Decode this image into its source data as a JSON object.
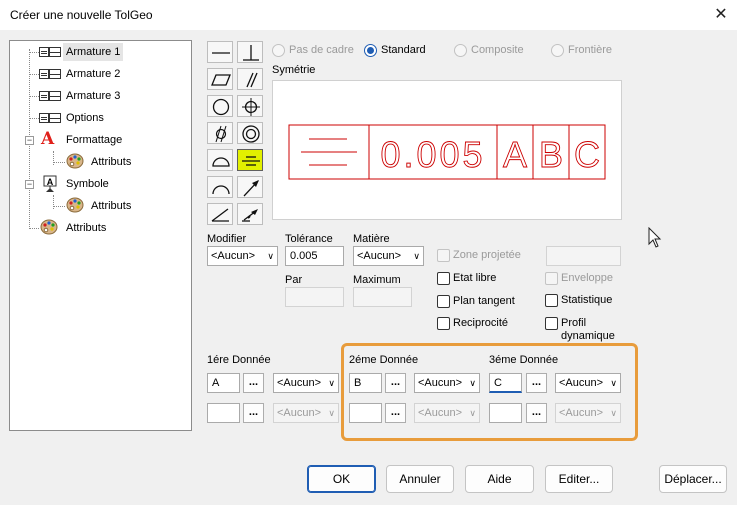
{
  "window": {
    "title": "Créer une nouvelle TolGeo",
    "close": "✕"
  },
  "tree": {
    "items": [
      {
        "label": "Armature 1",
        "icon": "frame-icon"
      },
      {
        "label": "Armature 2",
        "icon": "frame-icon"
      },
      {
        "label": "Armature 3",
        "icon": "frame-icon"
      },
      {
        "label": "Options",
        "icon": "frame-icon"
      },
      {
        "label": "Formattage",
        "icon": "letter-a-icon"
      },
      {
        "label": "Attributs",
        "icon": "palette-icon"
      },
      {
        "label": "Symbole",
        "icon": "symbol-icon"
      },
      {
        "label": "Attributs",
        "icon": "palette-icon"
      },
      {
        "label": "Attributs",
        "icon": "palette-icon"
      }
    ]
  },
  "frame_options": {
    "pas_de_cadre": "Pas de cadre",
    "standard": "Standard",
    "composite": "Composite",
    "frontiere": "Frontière",
    "selected": "Standard"
  },
  "preview": {
    "caption": "Symétrie",
    "tolerance_text": "0.005",
    "datums": [
      "A",
      "B",
      "C"
    ],
    "color": "#cc0000"
  },
  "fields": {
    "modifier": {
      "label": "Modifier",
      "value": "<Aucun>"
    },
    "tolerance": {
      "label": "Tolérance",
      "value": "0.005"
    },
    "matiere": {
      "label": "Matière",
      "value": "<Aucun>"
    },
    "par": {
      "label": "Par"
    },
    "maximum": {
      "label": "Maximum"
    }
  },
  "checks": {
    "zone_projetee": "Zone projetée",
    "etat_libre": "Etat libre",
    "enveloppe": "Enveloppe",
    "plan_tangent": "Plan tangent",
    "statistique": "Statistique",
    "reciprocite": "Reciprocité",
    "profil_dynamique_1": "Profil",
    "profil_dynamique_2": "dynamique"
  },
  "datums": {
    "first": {
      "label": "1ére Donnée",
      "value": "A",
      "modifier": "<Aucun>",
      "modifier2": "<Aucun>"
    },
    "second": {
      "label": "2éme Donnée",
      "value": "B",
      "modifier": "<Aucun>",
      "modifier2": "<Aucun>"
    },
    "third": {
      "label": "3éme Donnée",
      "value": "C",
      "modifier": "<Aucun>",
      "modifier2": "<Aucun>"
    },
    "ellipsis": "..."
  },
  "buttons": {
    "ok": "OK",
    "annuler": "Annuler",
    "aide": "Aide",
    "editer": "Editer...",
    "deplacer": "Déplacer..."
  },
  "colors": {
    "accent": "#1f5db3",
    "active_symbol": "#e2f000",
    "highlight_border": "#e89c3c",
    "preview_red": "#cc0000"
  }
}
